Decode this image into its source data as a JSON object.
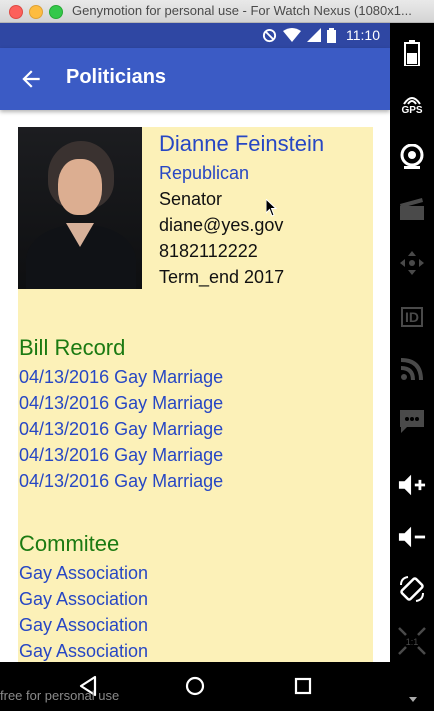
{
  "window": {
    "title": "Genymotion for personal use - For Watch Nexus (1080x1..."
  },
  "status_bar": {
    "time": "11:10"
  },
  "app_bar": {
    "title": "Politicians"
  },
  "politician": {
    "name": "Dianne Feinstein",
    "party": "Republican",
    "position": "Senator",
    "email": "diane@yes.gov",
    "phone": "8182112222",
    "term_end": "Term_end 2017"
  },
  "bill_record": {
    "title": "Bill Record",
    "items": [
      "04/13/2016 Gay Marriage",
      "04/13/2016 Gay Marriage",
      "04/13/2016 Gay Marriage",
      "04/13/2016 Gay Marriage",
      "04/13/2016 Gay Marriage"
    ]
  },
  "committee": {
    "title": "Commitee",
    "items": [
      "Gay Association",
      "Gay Association",
      "Gay Association",
      "Gay Association"
    ]
  },
  "watermark": "free for personal use",
  "side_panel": {
    "gps_label": "GPS",
    "id_label": "ID",
    "scale_label": "1:1"
  },
  "colors": {
    "app_bar": "#3b5bc5",
    "status_bar": "#2f47a3",
    "card_bg": "#fcf1b8",
    "link": "#2747c4",
    "section": "#1b7a12"
  }
}
